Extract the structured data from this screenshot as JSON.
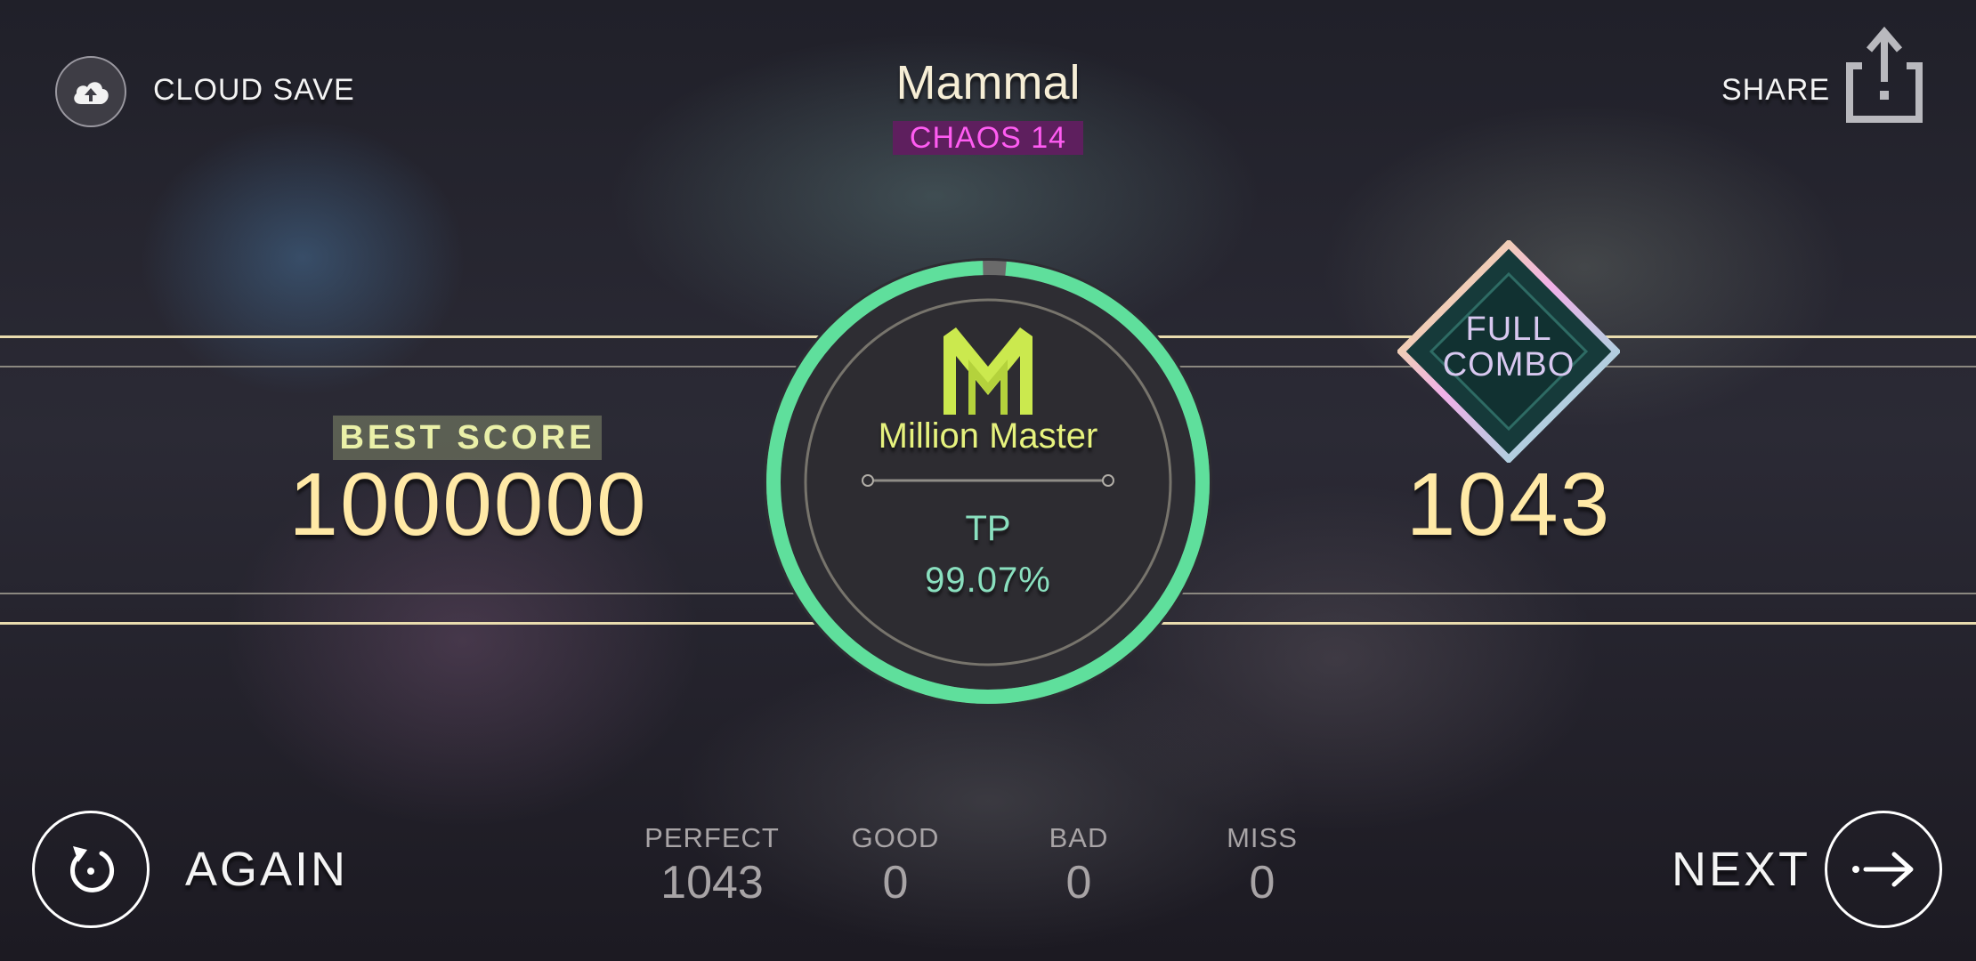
{
  "header": {
    "cloud_save_label": "CLOUD SAVE",
    "song_title": "Mammal",
    "difficulty": "CHAOS 14",
    "share_label": "SHARE"
  },
  "best_score": {
    "label": "BEST SCORE",
    "value": "1000000"
  },
  "result": {
    "rank_name": "Million Master",
    "tp_label": "TP",
    "tp_value": "99.07%",
    "tp_fraction": 0.9907
  },
  "combo": {
    "badge_line1": "FULL",
    "badge_line2": "COMBO",
    "value": "1043"
  },
  "judgements": [
    {
      "label": "PERFECT",
      "value": "1043"
    },
    {
      "label": "GOOD",
      "value": "0"
    },
    {
      "label": "BAD",
      "value": "0"
    },
    {
      "label": "MISS",
      "value": "0"
    }
  ],
  "footer": {
    "again_label": "AGAIN",
    "next_label": "NEXT"
  },
  "colors": {
    "ring_green": "#5fdf9c",
    "score_yellow": "#ffe9a6",
    "difficulty_magenta": "#ff5cf2",
    "rank_yellow_green": "#e6f27e"
  },
  "icons": {
    "cloud_save": "cloud-upload-icon",
    "share": "share-upload-icon",
    "again": "restart-icon",
    "next": "arrow-right-icon",
    "rank": "million-master-m-icon"
  }
}
